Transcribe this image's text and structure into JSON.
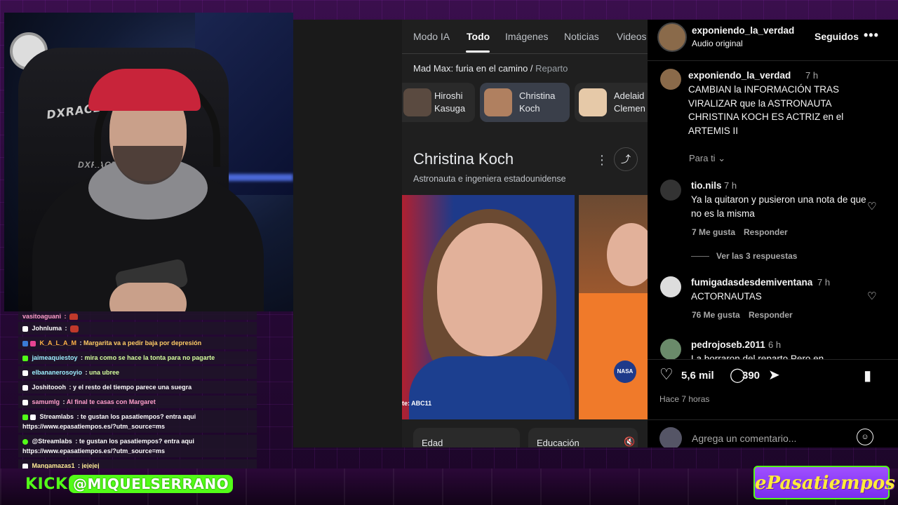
{
  "webcam": {
    "chair_brand": "DXRACER",
    "chair_brand_small": "DXRACER"
  },
  "chat": {
    "messages": [
      {
        "user": "vasitoaguani",
        "text": ""
      },
      {
        "user": "Johnluma",
        "text": ""
      },
      {
        "user": "K_A_L_A_M",
        "text": "Margarita va a pedir baja por depresión"
      },
      {
        "user": "jaimeaquiestoy",
        "text": "mira como se hace la tonta para no pagarte"
      },
      {
        "user": "elbananerosoyio",
        "text": "una ubree"
      },
      {
        "user": "Joshitoooh",
        "text": "y el resto del tiempo parece una suegra"
      },
      {
        "user": "samumlg",
        "text": "Al final te casas con Margaret"
      },
      {
        "user": "Streamlabs",
        "text": "te gustan los pasatiempos? entra aqui https://www.epasatiempos.es/?utm_source=ms"
      },
      {
        "user": "@Streamlabs",
        "text": "te gustan los pasatiempos? entra aqui https://www.epasatiempos.es/?utm_source=ms"
      },
      {
        "user": "Mangamazas1",
        "text": "jejejej"
      }
    ]
  },
  "branding": {
    "kick": "KICK",
    "handle": "@MIQUELSERRANO",
    "logo": "ePasatiempos"
  },
  "google": {
    "tabs": [
      "Modo IA",
      "Todo",
      "Imágenes",
      "Noticias",
      "Videos"
    ],
    "active_tab": "Todo",
    "breadcrumb_main": "Mad Max: furia en el camino",
    "breadcrumb_sep": " / ",
    "breadcrumb_sub": "Reparto",
    "cast": [
      {
        "name1": "Hiroshi",
        "name2": "Kasuga"
      },
      {
        "name1": "Christina",
        "name2": "Koch"
      },
      {
        "name1": "Adelaid",
        "name2": "Clemen"
      }
    ],
    "title": "Christina Koch",
    "subtitle": "Astronauta e ingeniera estadounidense",
    "image_caption": "te: ABC11",
    "patch_text": "NASA",
    "cards": [
      "Edad",
      "Educación"
    ]
  },
  "instagram": {
    "header_user": "exponiendo_la_verdad",
    "header_audio": "Audio original",
    "follow_state": "Seguidos",
    "more": "•••",
    "caption_user": "exponiendo_la_verdad",
    "caption_time": "7 h",
    "caption_text": "CAMBIAN la INFORMACIÓN TRAS VIRALIZAR que la ASTRONAUTA CHRISTINA KOCH ES ACTRIZ en el ARTEMIS II",
    "para_ti": "Para ti",
    "comments": [
      {
        "user": "tio.nils",
        "time": "7 h",
        "text": "Ya la quitaron y pusieron una nota de que no es la misma",
        "likes": "7 Me gusta",
        "reply": "Responder"
      },
      {
        "user": "fumigadasdesdemiventana",
        "time": "7 h",
        "text": "ACTORNAUTAS",
        "likes": "76 Me gusta",
        "reply": "Responder"
      },
      {
        "user": "pedrojoseb.2011",
        "time": "6 h",
        "text": "La borraron del reparto Pero en"
      }
    ],
    "view_replies": "Ver las 3 respuestas",
    "like_count": "5,6 mil",
    "comment_count": "390",
    "time_ago": "Hace 7 horas",
    "comment_placeholder": "Agrega un comentario..."
  }
}
